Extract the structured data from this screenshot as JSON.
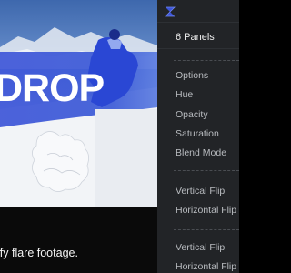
{
  "preview": {
    "title_text": "DROP",
    "caption": "ify flare footage."
  },
  "panel": {
    "icon": "hourglass-logo-icon",
    "title": "6 Panels",
    "items": [
      "Options",
      "Hue",
      "Opacity",
      "Saturation",
      "Blend Mode",
      "Vertical Flip",
      "Horizontal Flip",
      "Vertical Flip",
      "Horizontal Flip"
    ]
  },
  "colors": {
    "panel_bg": "#222427",
    "accent": "#3d55d8"
  }
}
